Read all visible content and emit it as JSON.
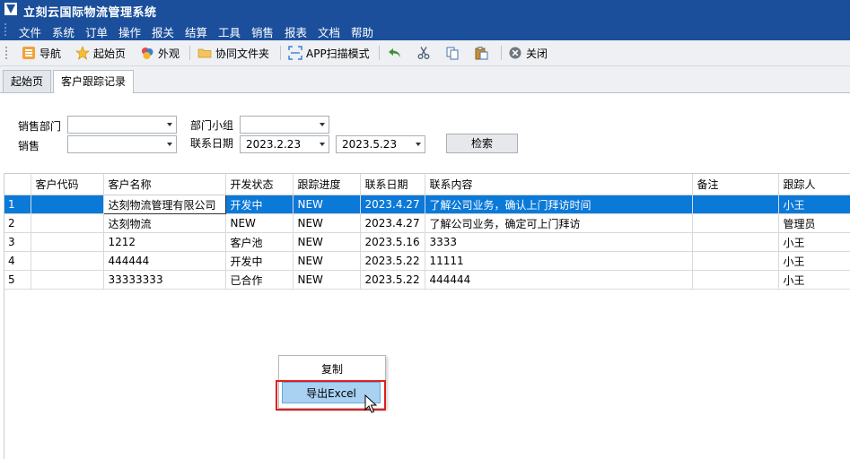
{
  "window": {
    "title": "立刻云国际物流管理系统"
  },
  "menu": [
    "文件",
    "系统",
    "订单",
    "操作",
    "报关",
    "结算",
    "工具",
    "销售",
    "报表",
    "文档",
    "帮助"
  ],
  "toolbar": {
    "nav": "导航",
    "home": "起始页",
    "appearance": "外观",
    "shared_folder": "协同文件夹",
    "app_scan": "APP扫描模式",
    "close": "关闭"
  },
  "tabs": [
    "起始页",
    "客户跟踪记录"
  ],
  "filters": {
    "sales_dept_label": "销售部门",
    "sales_dept_value": "",
    "dept_group_label": "部门小组",
    "dept_group_value": "",
    "sales_label": "销售",
    "sales_value": "",
    "contact_date_label": "联系日期",
    "date_from": "2023.2.23",
    "date_to": "2023.5.23",
    "search_button": "检索"
  },
  "table": {
    "columns": [
      "",
      "客户代码",
      "客户名称",
      "开发状态",
      "跟踪进度",
      "联系日期",
      "联系内容",
      "备注",
      "跟踪人"
    ],
    "rows": [
      [
        "1",
        "",
        "达刻物流管理有限公司",
        "开发中",
        "NEW",
        "2023.4.27",
        "了解公司业务，确认上门拜访时间",
        "",
        "小王"
      ],
      [
        "2",
        "",
        "达刻物流",
        "NEW",
        "NEW",
        "2023.4.27",
        "了解公司业务，确定可上门拜访",
        "",
        "管理员"
      ],
      [
        "3",
        "",
        "1212",
        "客户池",
        "NEW",
        "2023.5.16",
        "3333",
        "",
        "小王"
      ],
      [
        "4",
        "",
        "444444",
        "开发中",
        "NEW",
        "2023.5.22",
        "11111",
        "",
        "小王"
      ],
      [
        "5",
        "",
        "33333333",
        "已合作",
        "NEW",
        "2023.5.22",
        "444444",
        "",
        "小王"
      ]
    ],
    "selected_row": 0
  },
  "context_menu": {
    "items": [
      "复制",
      "导出Excel"
    ],
    "highlighted": "导出Excel"
  },
  "colors": {
    "titlebar": "#1b4f9c",
    "selection": "#0b79d8",
    "highlight_box": "#e0201c"
  }
}
